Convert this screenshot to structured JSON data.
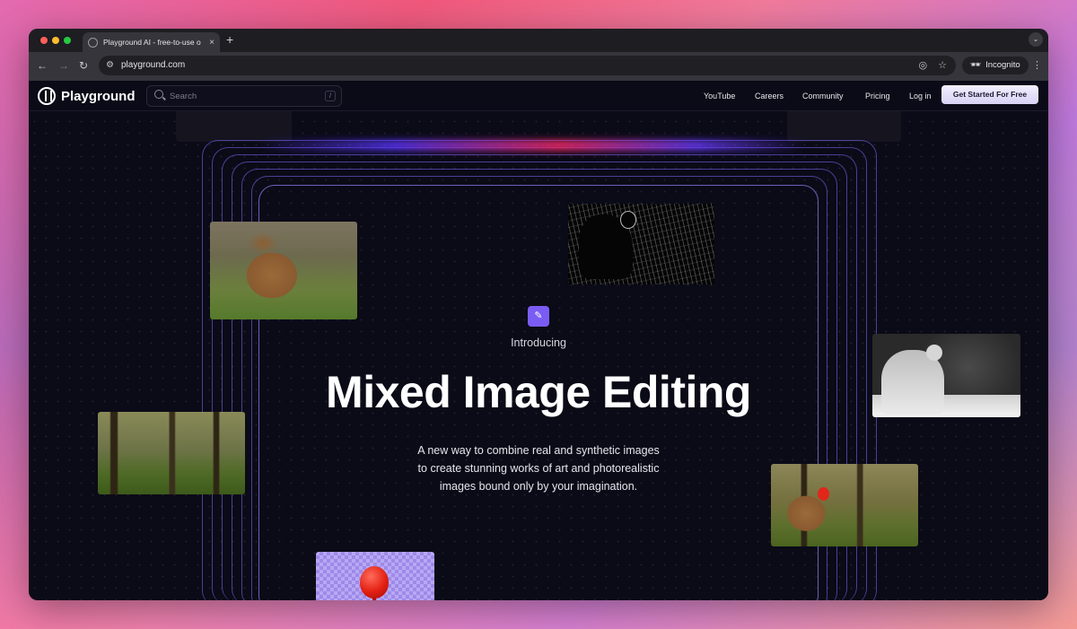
{
  "browser": {
    "tab_title": "Playground AI - free-to-use o",
    "tab_close": "×",
    "new_tab": "+",
    "url": "playground.com",
    "incognito_label": "Incognito",
    "icons": [
      "back-icon",
      "forward-icon",
      "reload-icon",
      "site-settings-icon",
      "eye-off-icon",
      "star-icon",
      "incognito-icon",
      "menu-icon"
    ]
  },
  "site": {
    "brand": "Playground",
    "search_placeholder": "Search",
    "search_shortcut": "/",
    "nav": [
      "YouTube",
      "Careers",
      "Community",
      "Pricing",
      "Log in"
    ],
    "cta": "Get Started For Free"
  },
  "hero": {
    "eyebrow": "Introducing",
    "title": "Mixed Image Editing",
    "subtitle_lines": [
      "A new way to combine real and synthetic images",
      "to create stunning works of art and photorealistic",
      "images bound only by your imagination."
    ]
  },
  "colors": {
    "accent": "#7a5cf5",
    "background": "#0b0a17",
    "cta_bg": "#e9e5fc"
  }
}
